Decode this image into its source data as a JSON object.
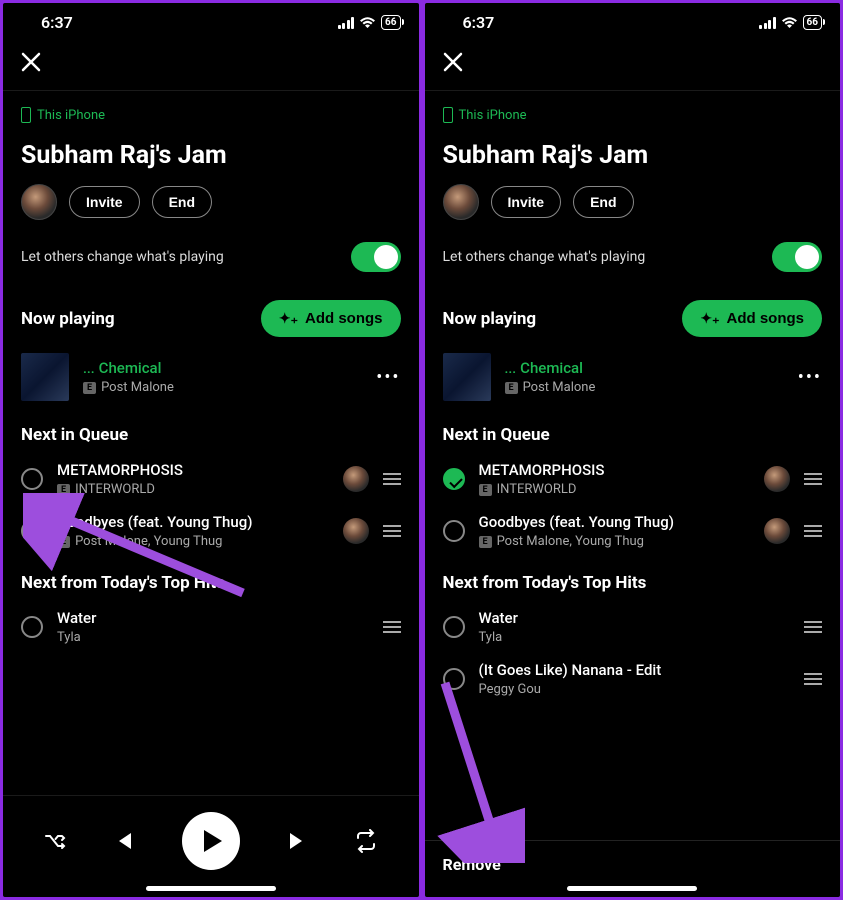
{
  "status": {
    "time": "6:37",
    "battery": "66"
  },
  "device_label": "This iPhone",
  "jam_title": "Subham Raj's Jam",
  "buttons": {
    "invite": "Invite",
    "end": "End",
    "add_songs": "Add songs",
    "remove": "Remove"
  },
  "permission": {
    "label": "Let others change what's playing",
    "on": true
  },
  "sections": {
    "now_playing": "Now playing",
    "next_queue": "Next in Queue",
    "next_from": "Next from Today's Top Hits"
  },
  "now_playing": {
    "prefix": "...",
    "title": "Chemical",
    "artist": "Post Malone",
    "explicit": "E"
  },
  "queue": [
    {
      "title": "METAMORPHOSIS",
      "artist": "INTERWORLD",
      "explicit": "E"
    },
    {
      "title": "Goodbyes (feat. Young Thug)",
      "artist": "Post Malone, Young Thug",
      "explicit": "E"
    }
  ],
  "next_from": [
    {
      "title": "Water",
      "artist": "Tyla"
    },
    {
      "title": "(It Goes Like) Nanana - Edit",
      "artist": "Peggy Gou"
    }
  ]
}
